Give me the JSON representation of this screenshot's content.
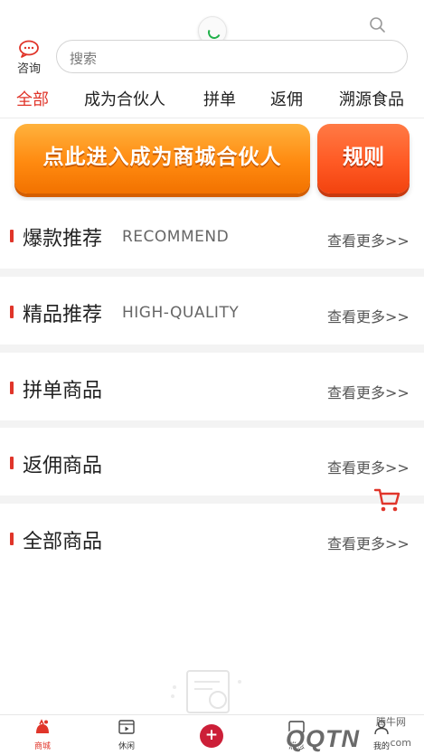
{
  "header": {
    "consult_label": "咨询",
    "search_placeholder": "搜索"
  },
  "tabs": [
    {
      "label": "全部",
      "active": true
    },
    {
      "label": "成为合伙人",
      "active": false
    },
    {
      "label": "拼单",
      "active": false
    },
    {
      "label": "返佣",
      "active": false
    },
    {
      "label": "溯源食品",
      "active": false
    }
  ],
  "banner": {
    "partner_label": "点此进入成为商城合伙人",
    "rules_label": "规则"
  },
  "sections": [
    {
      "title": "爆款推荐",
      "subtitle": "RECOMMEND",
      "more": "查看更多>>"
    },
    {
      "title": "精品推荐",
      "subtitle": "HIGH-QUALITY",
      "more": "查看更多>>"
    },
    {
      "title": "拼单商品",
      "subtitle": "",
      "more": "查看更多>>"
    },
    {
      "title": "返佣商品",
      "subtitle": "",
      "more": "查看更多>>"
    },
    {
      "title": "全部商品",
      "subtitle": "",
      "more": "查看更多>>"
    }
  ],
  "bottom_nav": [
    {
      "label": "商城",
      "icon": "shop-icon",
      "active": true
    },
    {
      "label": "休闲",
      "icon": "video-icon",
      "active": false
    },
    {
      "label": "",
      "icon": "add-icon",
      "active": false
    },
    {
      "label": "消息",
      "icon": "message-icon",
      "active": false
    },
    {
      "label": "我的",
      "icon": "user-icon",
      "active": false
    }
  ],
  "watermark": {
    "small": "腾牛网",
    "big": "QQTN",
    "com": ".com"
  },
  "colors": {
    "accent": "#e0352a",
    "partner_button": "#ff8a10",
    "rules_button": "#ff5a24",
    "add_button": "#cc1f38"
  }
}
